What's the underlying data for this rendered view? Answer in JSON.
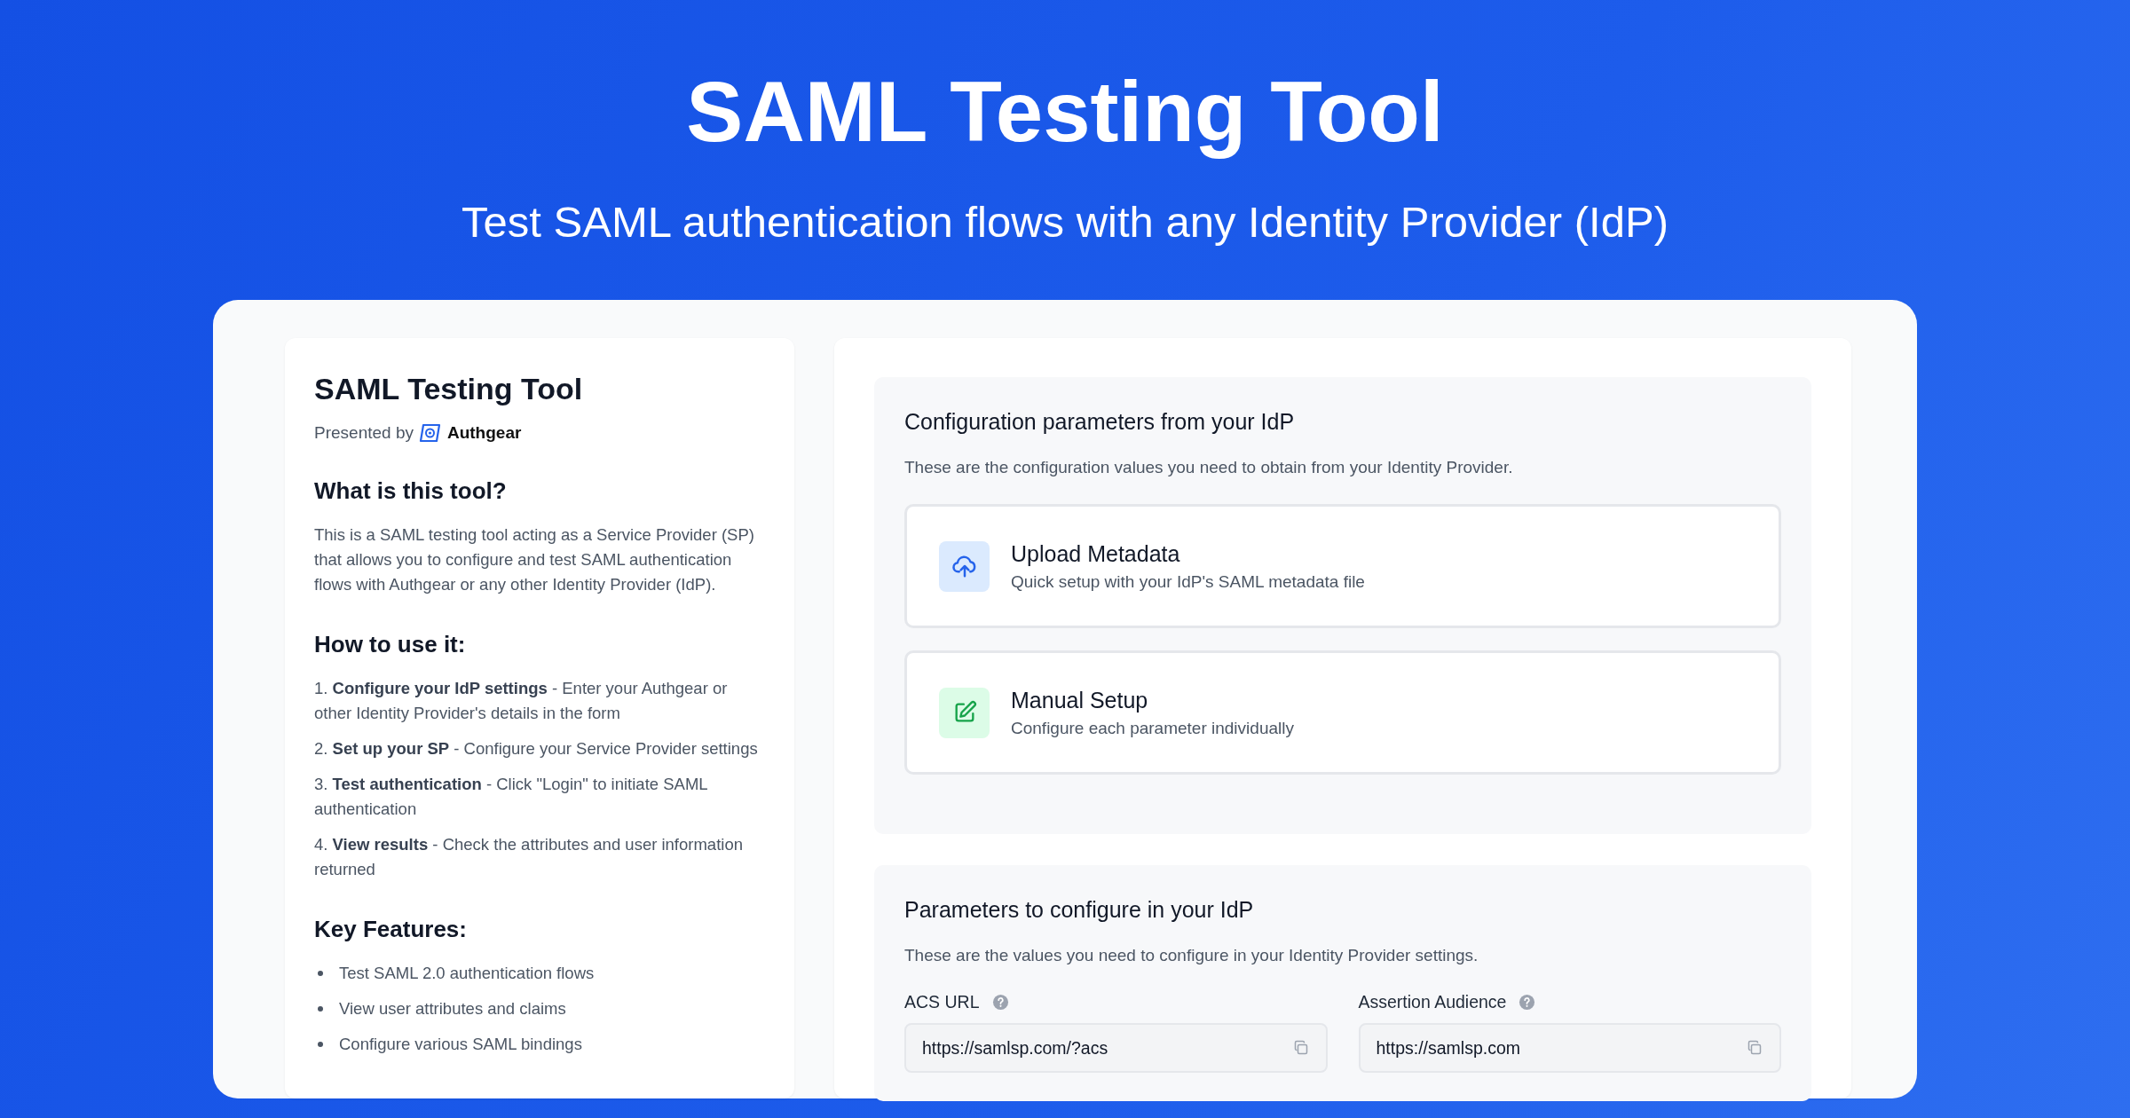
{
  "hero": {
    "title": "SAML Testing Tool",
    "subtitle": "Test SAML authentication flows with any Identity Provider (IdP)"
  },
  "info_card": {
    "title": "SAML Testing Tool",
    "presented_by": "Presented by",
    "brand": "Authgear",
    "sections": [
      {
        "kind": "paragraph",
        "heading": "What is this tool?",
        "text": "This is a SAML testing tool acting as a Service Provider (SP) that allows you to configure and test SAML authentication flows with Authgear or any other Identity Provider (IdP)."
      },
      {
        "kind": "steps",
        "heading": "How to use it:",
        "items": [
          "1. **Configure your IdP settings** - Enter your Authgear or other Identity Provider's details in the form",
          "2. **Set up your SP** - Configure your Service Provider settings",
          "3. **Test authentication** - Click \"Login\" to initiate SAML authentication",
          "4. **View results** - Check the attributes and user information returned"
        ]
      },
      {
        "kind": "bullets",
        "heading": "Key Features:",
        "items": [
          "Test SAML 2.0 authentication flows",
          "View user attributes and claims",
          "Configure various SAML bindings"
        ]
      }
    ]
  },
  "config_section": {
    "heading": "Configuration parameters from your IdP",
    "description": "These are the configuration values you need to obtain from your Identity Provider.",
    "options": [
      {
        "kind": "upload",
        "title": "Upload Metadata",
        "subtitle": "Quick setup with your IdP's SAML metadata file"
      },
      {
        "kind": "manual",
        "title": "Manual Setup",
        "subtitle": "Configure each parameter individually"
      }
    ]
  },
  "params_section": {
    "heading": "Parameters to configure in your IdP",
    "description": "These are the values you need to configure in your Identity Provider settings.",
    "fields": [
      {
        "label": "ACS URL",
        "value": "https://samlsp.com/?acs"
      },
      {
        "label": "Assertion Audience",
        "value": "https://samlsp.com"
      }
    ]
  }
}
